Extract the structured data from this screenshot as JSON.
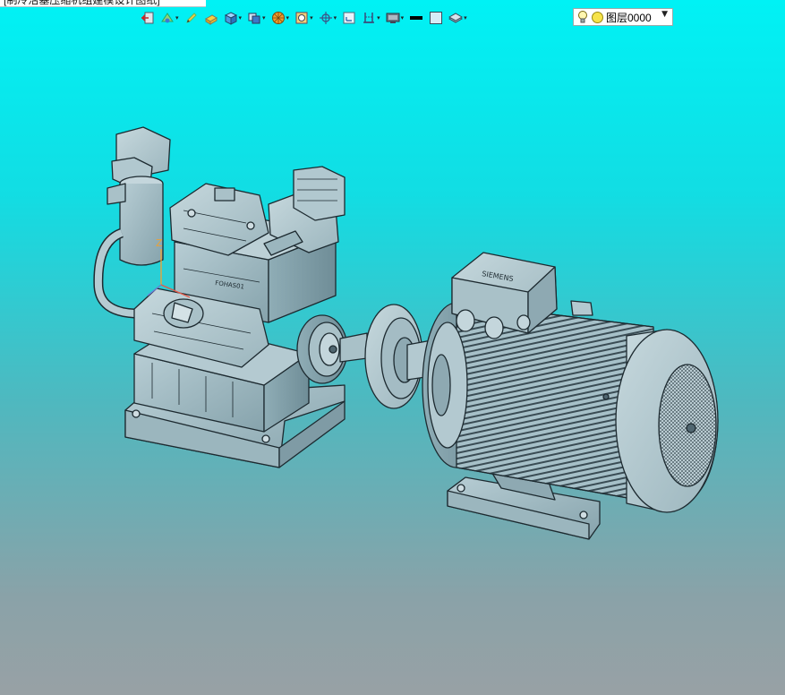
{
  "statusbar": {
    "text": "[制冷活塞压缩机组建模设计图纸]"
  },
  "toolbar": {
    "items": [
      {
        "icon": "exit-sketch-icon",
        "dropdown": false
      },
      {
        "icon": "sketch-tools-icon",
        "dropdown": true
      },
      {
        "icon": "pencil-icon",
        "dropdown": false
      },
      {
        "icon": "extrude-icon",
        "dropdown": false
      },
      {
        "icon": "solid-box-icon",
        "dropdown": true
      },
      {
        "icon": "view-cube-icon",
        "dropdown": true
      },
      {
        "icon": "render-style-icon",
        "dropdown": true
      },
      {
        "icon": "zoom-fit-icon",
        "dropdown": true
      },
      {
        "icon": "move-pan-icon",
        "dropdown": true
      },
      {
        "icon": "select-filter-icon",
        "dropdown": false
      },
      {
        "icon": "section-view-icon",
        "dropdown": true
      },
      {
        "icon": "display-monitor-icon",
        "dropdown": true
      },
      {
        "icon": "line-color-icon",
        "dropdown": false
      },
      {
        "icon": "fill-color-icon",
        "dropdown": false
      },
      {
        "icon": "layer-manager-icon",
        "dropdown": true
      }
    ]
  },
  "layer": {
    "name": "图层0000",
    "color": "#f6e34a"
  },
  "model": {
    "compressor_nameplate": "FOHAS01",
    "motor_badge": "SIEMENS",
    "axis_z": "Z"
  },
  "colors": {
    "body": "#9ab7c0",
    "edge": "#1d2a30",
    "viewport_top": "#00f2f5",
    "viewport_bottom": "#98a1a5"
  }
}
